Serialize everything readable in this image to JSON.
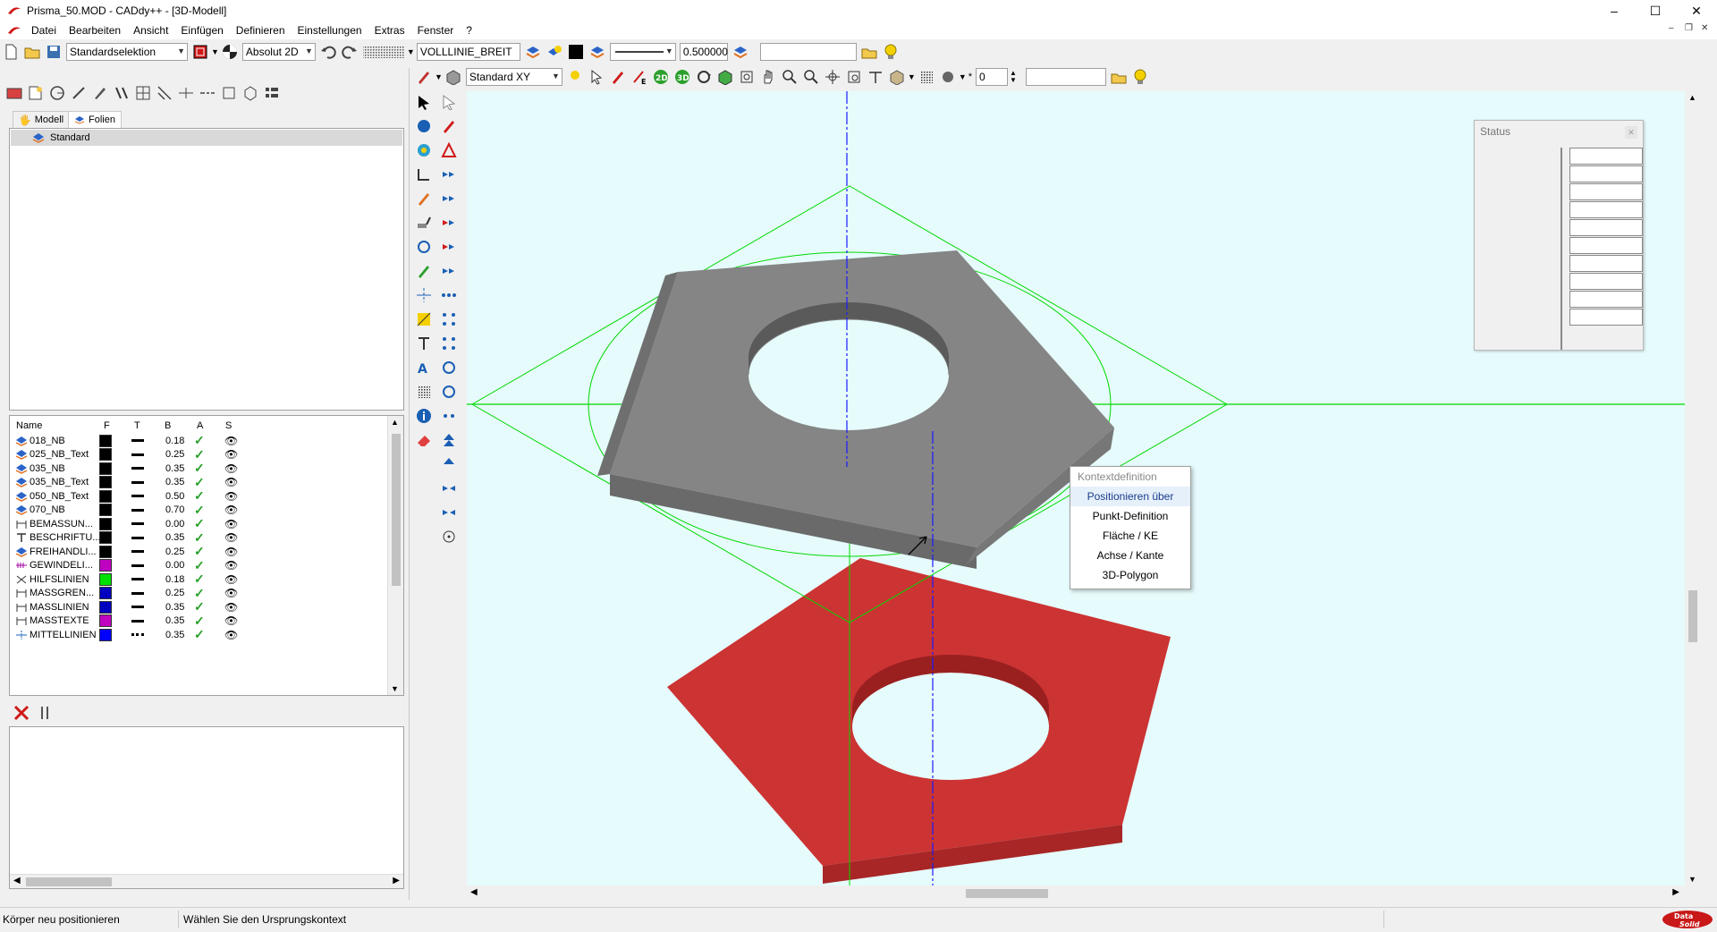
{
  "window": {
    "title": "Prisma_50.MOD  -  CADdy++ - [3D-Modell]",
    "controls": [
      "–",
      "☐",
      "✕"
    ]
  },
  "menu": [
    "Datei",
    "Bearbeiten",
    "Ansicht",
    "Einfügen",
    "Definieren",
    "Einstellungen",
    "Extras",
    "Fenster",
    "?"
  ],
  "toolbar1": {
    "selection_mode": "Standardselektion",
    "coord_mode": "Absolut 2D",
    "line_style": "VOLLLINIE_BREIT",
    "line_width": "0.500000",
    "search_value": ""
  },
  "toolbar2": {
    "view_plane": "Standard XY",
    "layer_index": "0",
    "value_field": ""
  },
  "left_panel": {
    "tabs": [
      {
        "label": "Modell",
        "active": false
      },
      {
        "label": "Folien",
        "active": true
      }
    ],
    "tree_root": "Standard",
    "columns": [
      "Name",
      "F",
      "T",
      "B",
      "A",
      "S"
    ],
    "layers": [
      {
        "name": "018_NB",
        "color": "#000000",
        "width": "0.18",
        "icon": "layer-icon",
        "linetype": "solid"
      },
      {
        "name": "025_NB_Text",
        "color": "#000000",
        "width": "0.25",
        "icon": "layer-icon",
        "linetype": "solid"
      },
      {
        "name": "035_NB",
        "color": "#000000",
        "width": "0.35",
        "icon": "layer-icon",
        "linetype": "solid"
      },
      {
        "name": "035_NB_Text",
        "color": "#000000",
        "width": "0.35",
        "icon": "layer-icon",
        "linetype": "solid"
      },
      {
        "name": "050_NB_Text",
        "color": "#000000",
        "width": "0.50",
        "icon": "layer-icon",
        "linetype": "solid"
      },
      {
        "name": "070_NB",
        "color": "#000000",
        "width": "0.70",
        "icon": "layer-icon",
        "linetype": "solid"
      },
      {
        "name": "BEMASSUN...",
        "color": "#000000",
        "width": "0.00",
        "icon": "dimension-icon",
        "linetype": "solid"
      },
      {
        "name": "BESCHRIFTU...",
        "color": "#000000",
        "width": "0.35",
        "icon": "text-icon",
        "linetype": "solid"
      },
      {
        "name": "FREIHANDLI...",
        "color": "#000000",
        "width": "0.25",
        "icon": "layer-icon",
        "linetype": "solid"
      },
      {
        "name": "GEWINDELI...",
        "color": "#c000c0",
        "width": "0.00",
        "icon": "thread-icon",
        "linetype": "solid"
      },
      {
        "name": "HILFSLINIEN",
        "color": "#00e000",
        "width": "0.18",
        "icon": "helpline-icon",
        "linetype": "solid"
      },
      {
        "name": "MASSGREN...",
        "color": "#0000c0",
        "width": "0.25",
        "icon": "dimension-icon",
        "linetype": "solid"
      },
      {
        "name": "MASSLINIEN",
        "color": "#0000c0",
        "width": "0.35",
        "icon": "dimension-icon",
        "linetype": "solid"
      },
      {
        "name": "MASSTEXTE",
        "color": "#c000c0",
        "width": "0.35",
        "icon": "dimension-icon",
        "linetype": "solid"
      },
      {
        "name": "MITTELLINIEN",
        "color": "#0000ff",
        "width": "0.35",
        "icon": "centerline-icon",
        "linetype": "dashdot"
      }
    ]
  },
  "context_menu": {
    "header": "Kontextdefinition",
    "items": [
      "Positionieren über",
      "Punkt-Definition",
      "Fläche / KE",
      "Achse / Kante",
      "3D-Polygon"
    ],
    "highlighted": 0
  },
  "status_window": {
    "title": "Status",
    "rows": 10
  },
  "statusbar": {
    "left": "Körper neu positionieren",
    "prompt": "Wählen Sie den Ursprungskontext"
  },
  "brand": "Data Solid",
  "colors": {
    "viewport_bg": "#e6fbfc",
    "prism_gray": "#828282",
    "prism_red": "#cc3333",
    "construction_green": "#00d800",
    "axis_blue": "#1a1aff"
  }
}
